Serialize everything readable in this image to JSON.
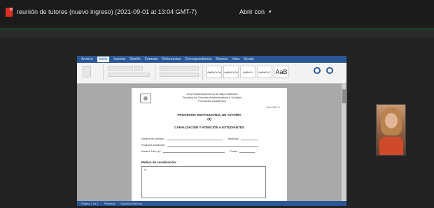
{
  "header": {
    "file_title": "reunión de tutores (nuevo ingreso) (2021-09-01 at 13:04 GMT-7)",
    "open_with_label": "Abrir con",
    "open_with_caret": "▾"
  },
  "ribbon": {
    "tabs": [
      "Archivo",
      "Inicio",
      "Insertar",
      "Diseño",
      "Formato",
      "Referencias",
      "Correspondencia",
      "Revisar",
      "Vista",
      "Ayuda"
    ],
    "styles": [
      "AaBbCcDd",
      "AaBbCcDd",
      "AaBbCc",
      "AaBbCcC",
      "AaB"
    ]
  },
  "document": {
    "header_lines": [
      "Universidad Autónoma de Baja California",
      "Facultad de Ciencias Administrativas y Sociales",
      "Formación Académica"
    ],
    "right_note": "Ciclo 2021-2",
    "program_title": "PROGRAMA INSTITUCIONAL DE TUTORÍA",
    "program_sub": "(3)",
    "section_title": "CANALIZACIÓN Y ATENCIÓN A ESTUDIANTES",
    "fields": [
      {
        "label": "Nombre del tutorado:",
        "label2": "Matrícula:"
      },
      {
        "label": "Programa académico:",
        "label2": ""
      },
      {
        "label": "Nombre Tutor (a):",
        "label2": "Fecha:"
      }
    ],
    "motivo_label": "Motivo de canalización:",
    "box_mark": "a)"
  },
  "statusbar": {
    "items": [
      "Página 1 de 1",
      "Palabras",
      "Español (México)"
    ]
  }
}
